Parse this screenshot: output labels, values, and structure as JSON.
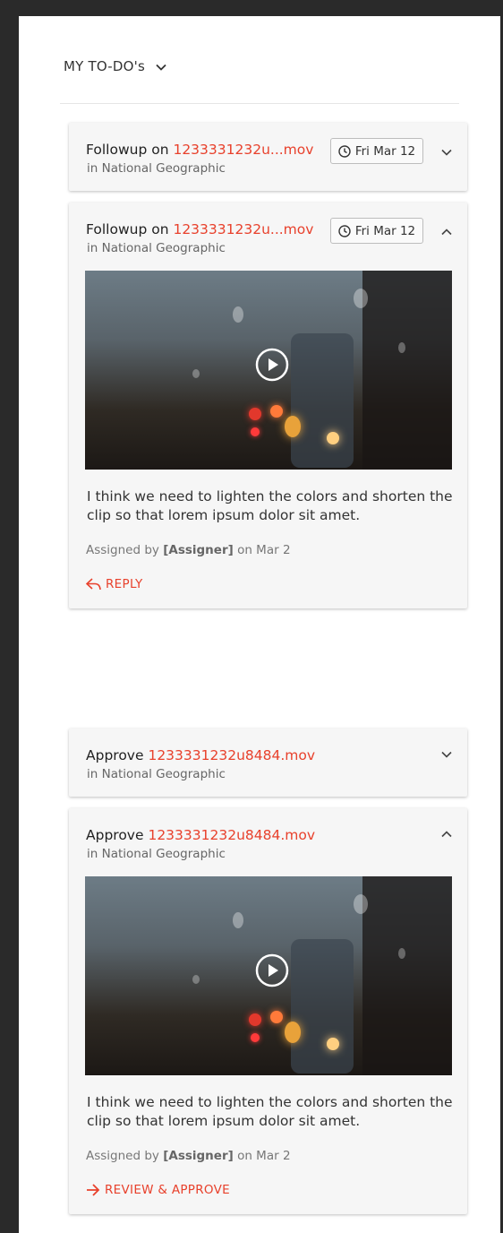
{
  "header": {
    "title": "MY TO-DO's"
  },
  "cards": [
    {
      "title_prefix": "Followup on",
      "file": "1233331232u...mov",
      "subtitle": "in National Geographic",
      "date": "Fri Mar 12",
      "expanded": false
    },
    {
      "title_prefix": "Followup on",
      "file": "1233331232u...mov",
      "subtitle": "in National Geographic",
      "date": "Fri Mar 12",
      "expanded": true,
      "comment": "I think we need to lighten the colors and shorten the clip so that lorem ipsum dolor sit amet.",
      "assigned_prefix": "Assigned by",
      "assigner": "[Assigner]",
      "assigned_suffix": "on Mar 2",
      "action_label": "REPLY"
    },
    {
      "title_prefix": "Approve",
      "file": "1233331232u8484.mov",
      "subtitle": "in National Geographic",
      "expanded": false
    },
    {
      "title_prefix": "Approve",
      "file": "1233331232u8484.mov",
      "subtitle": "in National Geographic",
      "expanded": true,
      "comment": "I think we need to lighten the colors and shorten the clip so that lorem ipsum dolor sit amet.",
      "assigned_prefix": "Assigned by",
      "assigner": "[Assigner]",
      "assigned_suffix": "on Mar 2",
      "action_label": "REVIEW & APPROVE"
    }
  ],
  "icons": {
    "header_toggle": "chevron-down-icon",
    "date": "clock-icon",
    "collapse": "chevron-up-icon",
    "expand": "chevron-down-icon",
    "play": "play-icon",
    "reply": "reply-icon",
    "approve": "arrow-right-icon"
  },
  "colors": {
    "accent": "#e8412c",
    "card_bg": "#f6f6f6",
    "backdrop": "#2a2a2a"
  }
}
